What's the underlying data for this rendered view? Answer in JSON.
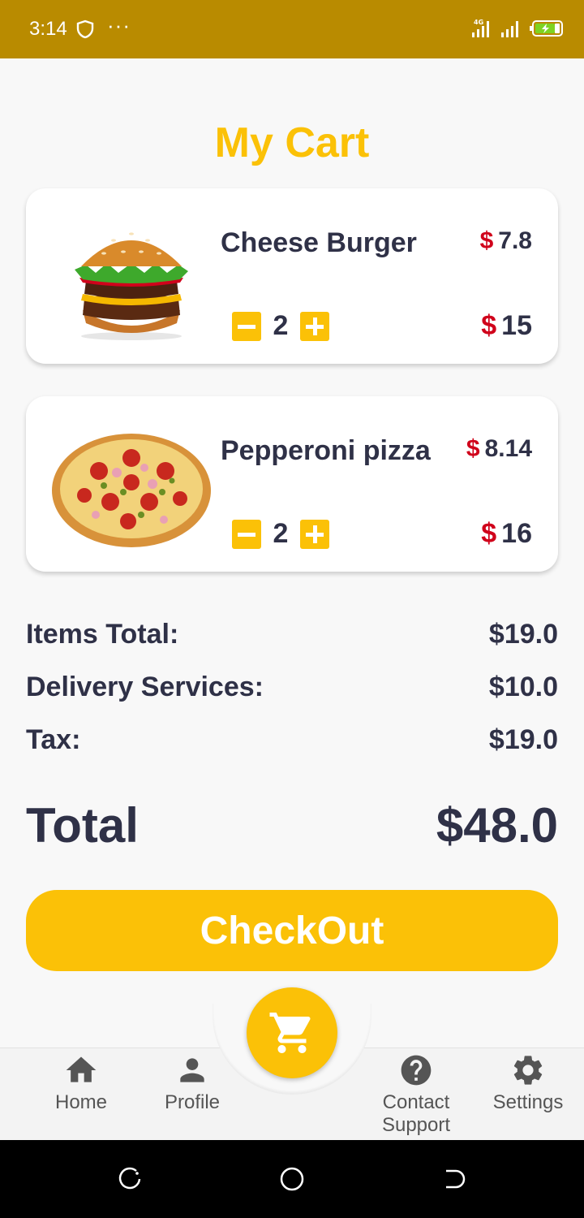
{
  "status_bar": {
    "time": "3:14",
    "dots": "···",
    "network": "4G"
  },
  "page": {
    "title": "My Cart"
  },
  "cart_items": [
    {
      "name": "Cheese Burger",
      "unit_currency": "$",
      "unit_price": "7.8",
      "quantity": "2",
      "subtotal_currency": "$",
      "subtotal": "15"
    },
    {
      "name": "Pepperoni pizza",
      "unit_currency": "$",
      "unit_price": "8.14",
      "quantity": "2",
      "subtotal_currency": "$",
      "subtotal": "16"
    }
  ],
  "summary": {
    "items_total_label": "Items Total:",
    "items_total_value": "$19.0",
    "delivery_label": "Delivery Services:",
    "delivery_value": "$10.0",
    "tax_label": "Tax:",
    "tax_value": "$19.0",
    "total_label": "Total",
    "total_value": "$48.0"
  },
  "checkout_label": "CheckOut",
  "nav": {
    "home": "Home",
    "profile": "Profile",
    "contact_line1": "Contact",
    "contact_line2": "Support",
    "settings": "Settings"
  },
  "colors": {
    "accent": "#fbc107",
    "price_red": "#d0021b",
    "text_dark": "#2f3147",
    "status_bar": "#b98b00"
  }
}
